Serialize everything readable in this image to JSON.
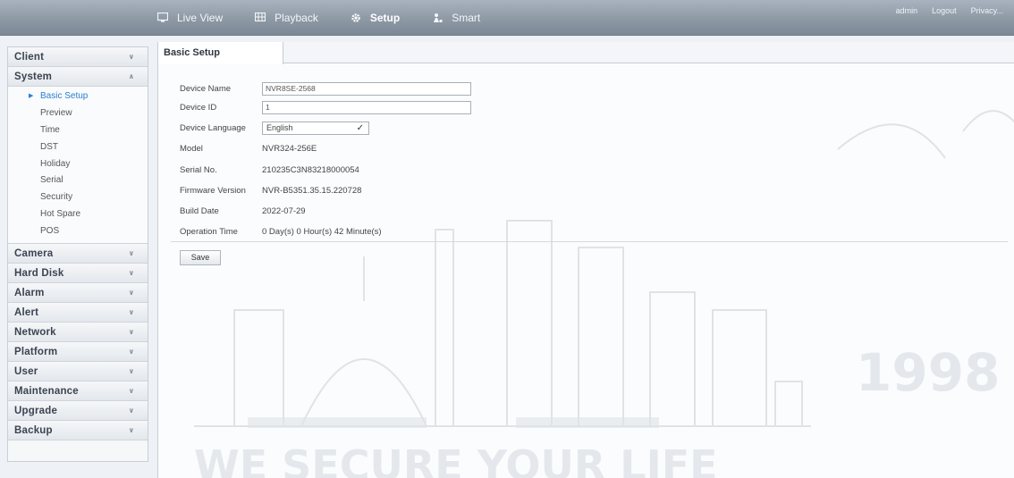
{
  "topbar": {
    "nav": [
      {
        "label": "Live View",
        "icon": "monitor-icon"
      },
      {
        "label": "Playback",
        "icon": "film-icon"
      },
      {
        "label": "Setup",
        "icon": "gear-icon",
        "active": true
      },
      {
        "label": "Smart",
        "icon": "person-icon"
      }
    ],
    "right": [
      "admin",
      "Logout",
      "Privacy..."
    ]
  },
  "sidebar": {
    "menus": [
      {
        "label": "Client",
        "expanded": false
      },
      {
        "label": "System",
        "expanded": true,
        "items": [
          "Basic Setup",
          "Preview",
          "Time",
          "DST",
          "Holiday",
          "Serial",
          "Security",
          "Hot Spare",
          "POS"
        ],
        "active_item": "Basic Setup"
      },
      {
        "label": "Camera",
        "expanded": false
      },
      {
        "label": "Hard Disk",
        "expanded": false
      },
      {
        "label": "Alarm",
        "expanded": false
      },
      {
        "label": "Alert",
        "expanded": false
      },
      {
        "label": "Network",
        "expanded": false
      },
      {
        "label": "Platform",
        "expanded": false
      },
      {
        "label": "User",
        "expanded": false
      },
      {
        "label": "Maintenance",
        "expanded": false
      },
      {
        "label": "Upgrade",
        "expanded": false
      },
      {
        "label": "Backup",
        "expanded": false
      }
    ]
  },
  "tab": {
    "label": "Basic Setup"
  },
  "form": {
    "device_name": {
      "label": "Device Name",
      "value": "NVR8SE-2568"
    },
    "device_id": {
      "label": "Device ID",
      "value": "1"
    },
    "device_language": {
      "label": "Device Language",
      "value": "English"
    },
    "model": {
      "label": "Model",
      "value": "NVR324-256E"
    },
    "serial_no": {
      "label": "Serial No.",
      "value": "210235C3N83218000054"
    },
    "firmware_version": {
      "label": "Firmware Version",
      "value": "NVR-B5351.35.15.220728"
    },
    "build_date": {
      "label": "Build Date",
      "value": "2022-07-29"
    },
    "operation_time": {
      "label": "Operation Time",
      "value": "0 Day(s)  0 Hour(s)  42 Minute(s)"
    },
    "save_label": "Save"
  },
  "watermark": {
    "slogan": "WE SECURE YOUR LIFE",
    "year": "1998"
  },
  "colors": {
    "accent": "#2a7fd1",
    "topbar": "#8e99a6"
  }
}
